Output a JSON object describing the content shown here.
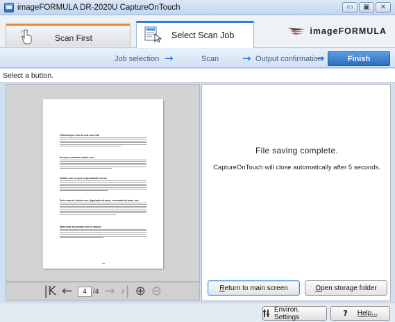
{
  "window": {
    "title": "imageFORMULA DR-2020U CaptureOnTouch",
    "minimize_glyph": "▭",
    "maximize_glyph": "▣",
    "close_glyph": "✕"
  },
  "tabs": {
    "scan_first": {
      "label": "Scan First",
      "icon": "hand-icon"
    },
    "select_scan_job": {
      "label": "Select Scan Job",
      "icon": "document-cursor-icon"
    }
  },
  "brand": {
    "text": "imageFORMULA",
    "icon": "canon-wing-logo"
  },
  "steps": {
    "job_selection": "Job selection",
    "scan": "Scan",
    "output_confirmation": "Output confirmation",
    "finish": "Finish",
    "arrow_glyph": "→"
  },
  "instruction": "Select a button.",
  "preview": {
    "headings": [
      "Pellentesque viverra erat non velit",
      "Aenean commodo varius orci",
      "Nullam non mi quis turpis blandit cursus",
      "Duis urna mi, lacinia nec, dignissim sit amet, venenatis sit amet, nec",
      "Maecenas accumsan velit in mauris"
    ],
    "page_current": "4",
    "page_total": "/4",
    "nav_icons": {
      "first": "K",
      "prev": "←",
      "next": "→",
      "last": "›|",
      "zoom_in": "⊕",
      "zoom_out": "⊖"
    }
  },
  "result": {
    "status": "File saving complete.",
    "message": "CaptureOnTouch will close automatically after 5 seconds.",
    "return_button": {
      "prefix": "R",
      "rest": "eturn to main screen"
    },
    "open_folder_button": {
      "prefix": "O",
      "rest": "pen storage folder"
    }
  },
  "bottom": {
    "environ_settings": "Environ. Settings",
    "help": "Help...",
    "help_glyph": "?"
  }
}
